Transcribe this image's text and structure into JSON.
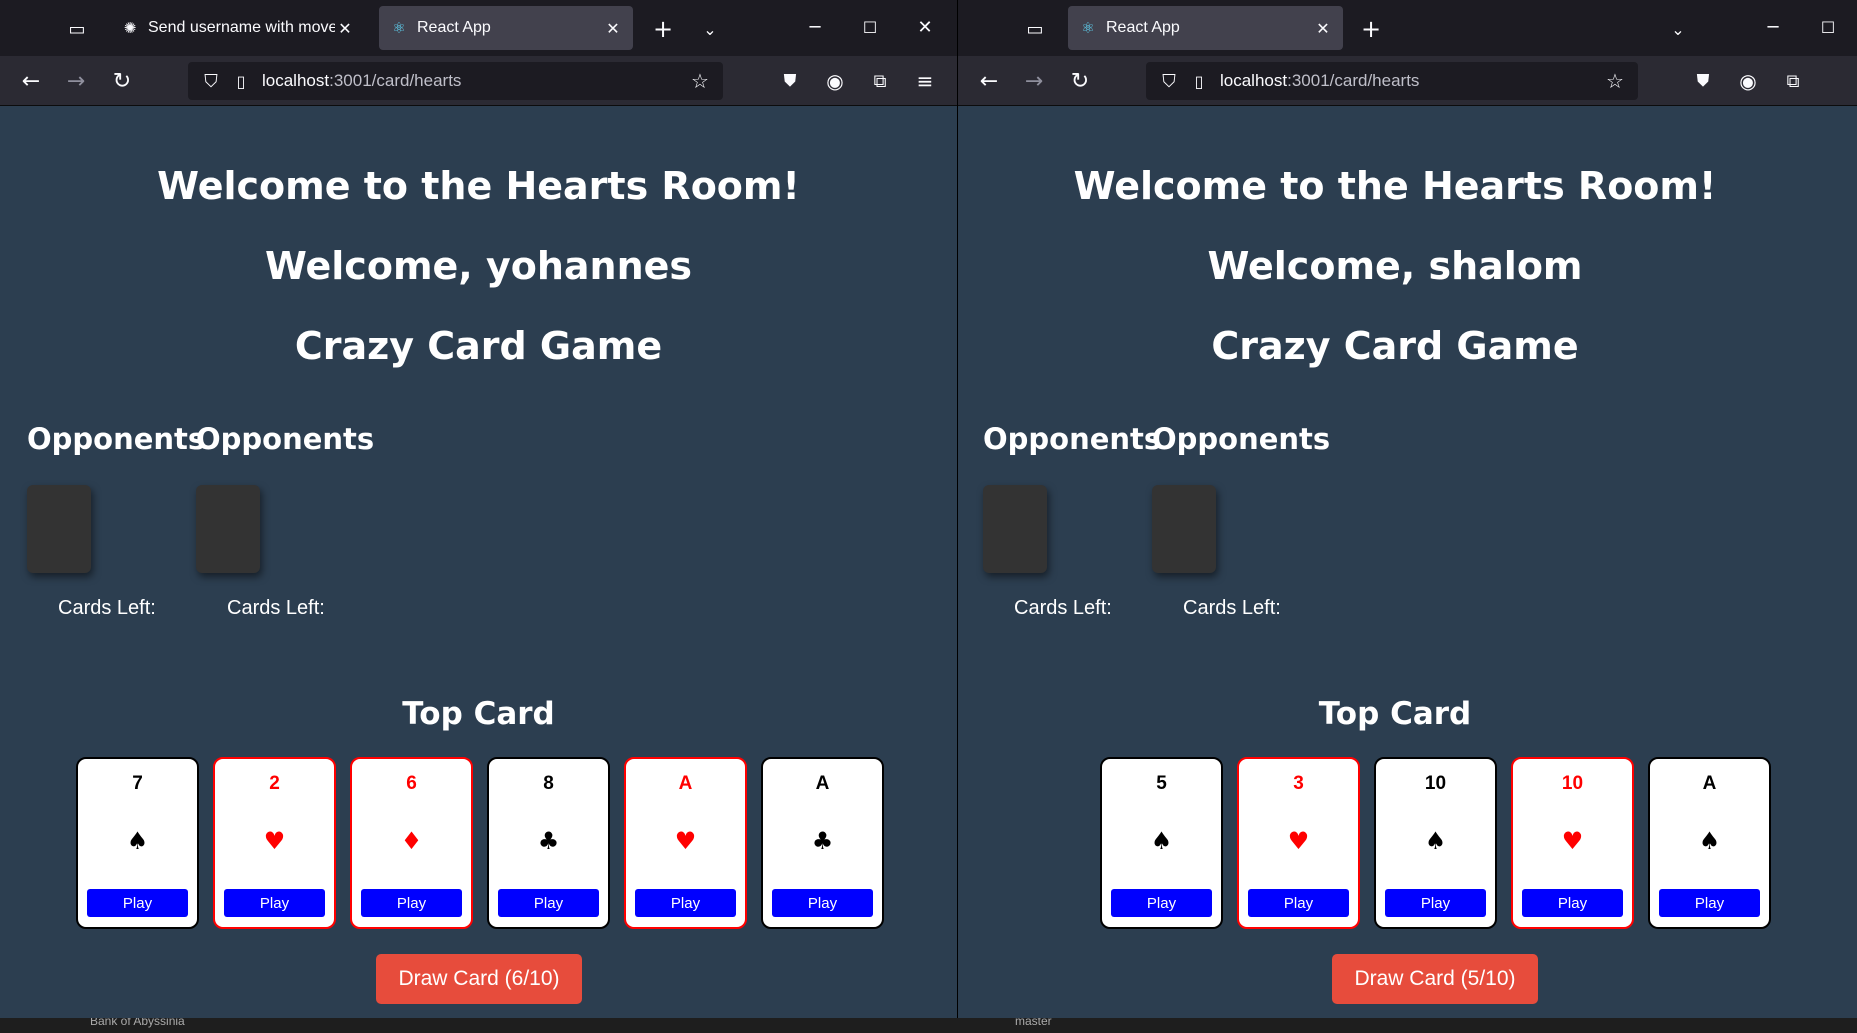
{
  "left_window": {
    "tabs": [
      {
        "label": "Send username with moves",
        "icon": "chatgpt-icon"
      },
      {
        "label": "React App",
        "icon": "react-icon",
        "active": true
      }
    ],
    "url": {
      "host": "localhost",
      "path": ":3001/card/hearts"
    },
    "page": {
      "room_title": "Welcome to the Hearts Room!",
      "welcome": "Welcome, yohannes",
      "game_title": "Crazy Card Game",
      "opponents": [
        {
          "heading": "Opponents",
          "cards_left_label": "Cards Left:"
        },
        {
          "heading": "Opponents",
          "cards_left_label": "Cards Left:"
        }
      ],
      "top_card_heading": "Top Card",
      "hand": [
        {
          "rank": "7",
          "suit": "♠",
          "suit_name": "spades",
          "color": "black",
          "button": "Play"
        },
        {
          "rank": "2",
          "suit": "♥",
          "suit_name": "hearts",
          "color": "red",
          "button": "Play"
        },
        {
          "rank": "6",
          "suit": "♦",
          "suit_name": "diamonds",
          "color": "red",
          "button": "Play"
        },
        {
          "rank": "8",
          "suit": "♣",
          "suit_name": "clubs",
          "color": "black",
          "button": "Play"
        },
        {
          "rank": "A",
          "suit": "♥",
          "suit_name": "hearts",
          "color": "red",
          "button": "Play"
        },
        {
          "rank": "A",
          "suit": "♣",
          "suit_name": "clubs",
          "color": "black",
          "button": "Play"
        }
      ],
      "draw_button": "Draw Card (6/10)"
    }
  },
  "right_window": {
    "tabs": [
      {
        "label": "React App",
        "icon": "react-icon",
        "active": true
      }
    ],
    "url": {
      "host": "localhost",
      "path": ":3001/card/hearts"
    },
    "page": {
      "room_title": "Welcome to the Hearts Room!",
      "welcome": "Welcome, shalom",
      "game_title": "Crazy Card Game",
      "opponents": [
        {
          "heading": "Opponents",
          "cards_left_label": "Cards Left:"
        },
        {
          "heading": "Opponents",
          "cards_left_label": "Cards Left:"
        }
      ],
      "top_card_heading": "Top Card",
      "hand": [
        {
          "rank": "5",
          "suit": "♠",
          "suit_name": "spades",
          "color": "black",
          "button": "Play"
        },
        {
          "rank": "3",
          "suit": "♥",
          "suit_name": "hearts",
          "color": "red",
          "button": "Play"
        },
        {
          "rank": "10",
          "suit": "♠",
          "suit_name": "spades",
          "color": "black",
          "button": "Play"
        },
        {
          "rank": "10",
          "suit": "♥",
          "suit_name": "hearts",
          "color": "red",
          "button": "Play"
        },
        {
          "rank": "A",
          "suit": "♠",
          "suit_name": "spades",
          "color": "black",
          "button": "Play"
        }
      ],
      "draw_button": "Draw Card (5/10)"
    }
  },
  "colors": {
    "page_bg": "#2c3e50",
    "play_button": "#0000ff",
    "draw_button": "#e74c3c",
    "red_suit": "#ff0000",
    "browser_chrome": "#1c1b22",
    "toolbar": "#2b2a33"
  },
  "taskbar": {
    "left_text": "Bank of Abyssinia",
    "right_text": "master"
  }
}
